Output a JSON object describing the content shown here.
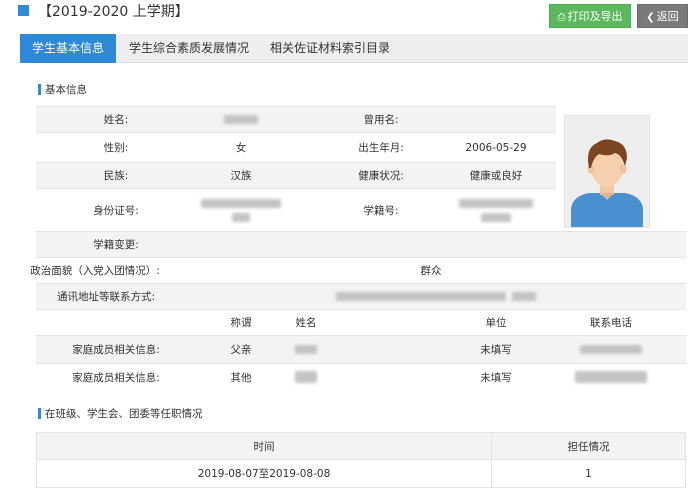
{
  "header": {
    "term": "【2019-2020 上学期】",
    "print_label": "打印及导出",
    "back_label": "返回"
  },
  "tabs": [
    {
      "label": "学生基本信息",
      "active": true
    },
    {
      "label": "学生综合素质发展情况",
      "active": false
    },
    {
      "label": "相关佐证材料索引目录",
      "active": false
    }
  ],
  "basic": {
    "section_title": "基本信息",
    "name_label": "姓名:",
    "former_name_label": "曾用名:",
    "gender_label": "性别:",
    "gender": "女",
    "birth_label": "出生年月:",
    "birth": "2006-05-29",
    "ethnicity_label": "民族:",
    "ethnicity": "汉族",
    "health_label": "健康状况:",
    "health": "健康或良好",
    "id_label": "身份证号:",
    "student_no_label": "学籍号:",
    "change_label": "学籍变更:",
    "political_label": "政治面貌（入党入团情况）:",
    "political": "群众",
    "address_label": "通讯地址等联系方式:",
    "family_headers": {
      "relation": "称谓",
      "name": "姓名",
      "work": "单位",
      "phone": "联系电话"
    },
    "family": [
      {
        "label": "家庭成员相关信息:",
        "relation": "父亲",
        "work": "未填写"
      },
      {
        "label": "家庭成员相关信息:",
        "relation": "其他",
        "work": "未填写"
      }
    ]
  },
  "positions": {
    "section_title": "在班级、学生会、团委等任职情况",
    "col_time": "时间",
    "col_status": "担任情况",
    "rows": [
      {
        "time": "2019-08-07至2019-08-08",
        "status": "1"
      }
    ]
  },
  "colors": {
    "primary": "#2e8ad8",
    "print_button": "#5cb85c",
    "back_button": "#7a7a7a"
  },
  "icons": {
    "print": "printer-icon",
    "back": "chevron-left-icon",
    "avatar": "student-avatar"
  }
}
